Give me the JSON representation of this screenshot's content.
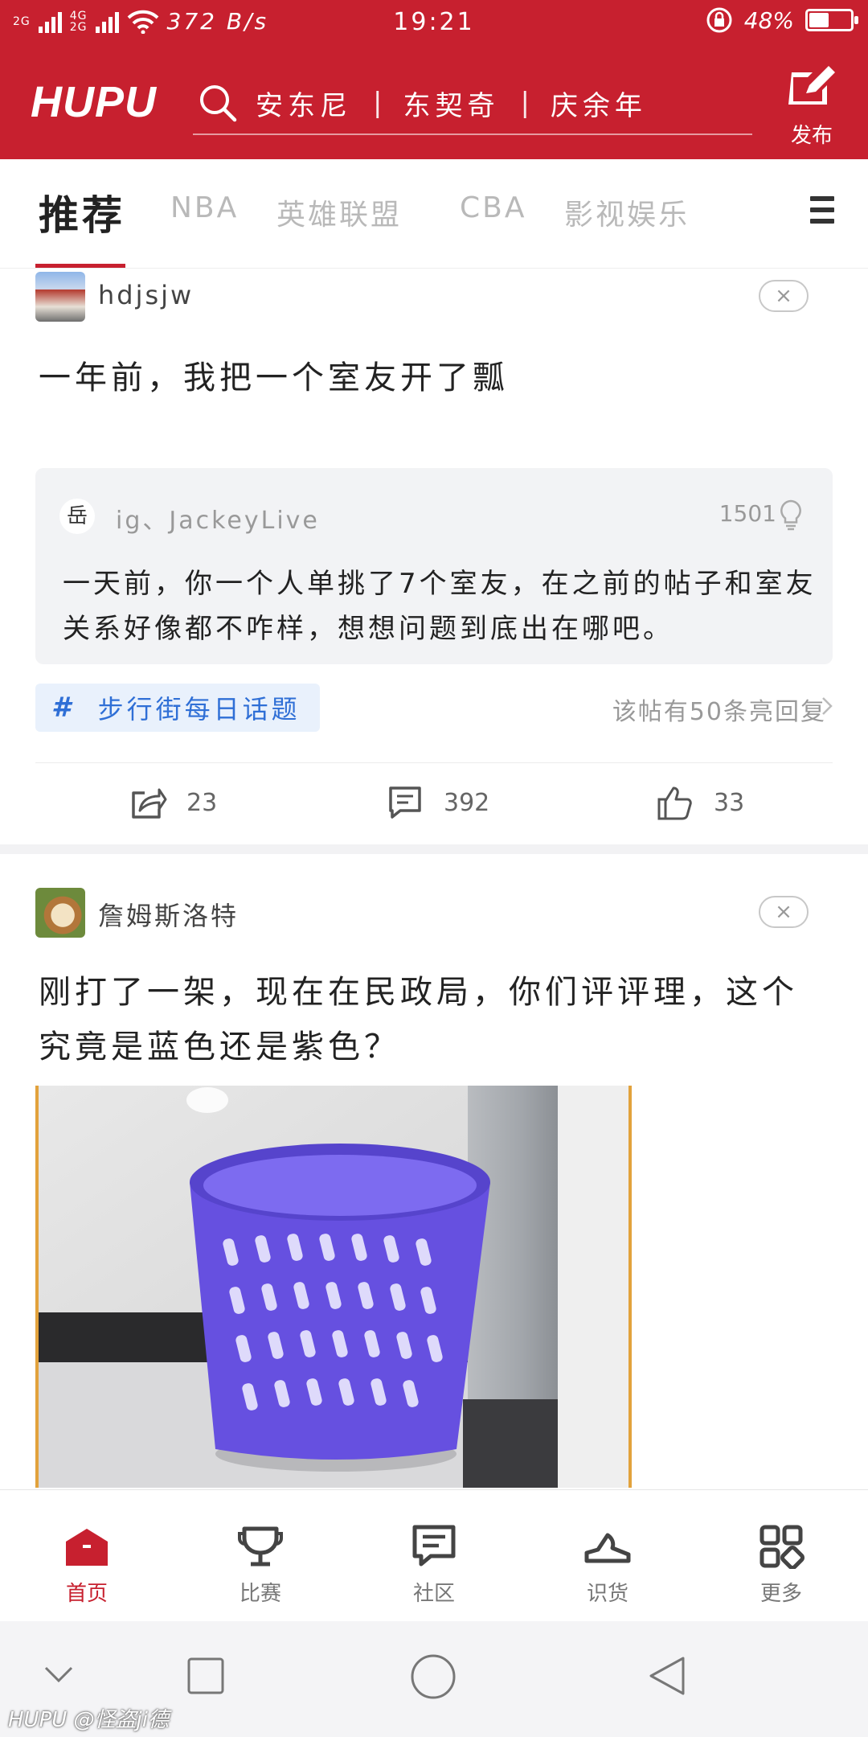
{
  "status_bar": {
    "network1": "2G",
    "network2a": "4G",
    "network2b": "2G",
    "speed": "372 B/s",
    "time": "19:21",
    "battery": "48%",
    "battery_level": 0.48
  },
  "header": {
    "logo": "HUPU",
    "search_hot_1": "安东尼",
    "search_hot_2": "东契奇",
    "search_hot_3": "庆余年",
    "separator": "|",
    "publish_label": "发布"
  },
  "tabs": [
    "推荐",
    "NBA",
    "英雄联盟",
    "CBA",
    "影视娱乐"
  ],
  "feed": {
    "post1": {
      "username": "hdjsjw",
      "title": "一年前，我把一个室友开了瓢",
      "quote": {
        "avatar_char": "岳",
        "username": "ig、JackeyLive",
        "likes": "1501",
        "text": "一天前，你一个人单挑了7个室友，在之前的帖子和室友关系好像都不咋样，想想问题到底出在哪吧。"
      },
      "topic": "步行街每日话题",
      "topic_hash": "#",
      "light_replies": "该帖有50条亮回复",
      "shares": "23",
      "comments": "392",
      "likes": "33"
    },
    "post2": {
      "username": "詹姆斯洛特",
      "title": "刚打了一架，现在在民政局，你们评评理，这个究竟是蓝色还是紫色？"
    },
    "close_icon": "×"
  },
  "bottom_nav": [
    "首页",
    "比赛",
    "社区",
    "识货",
    "更多"
  ],
  "watermark": "HUPU @怪盗ji德",
  "colors": {
    "brand": "#c7202f",
    "topic_blue": "#2f6fd6",
    "basket": "#6650e0"
  }
}
